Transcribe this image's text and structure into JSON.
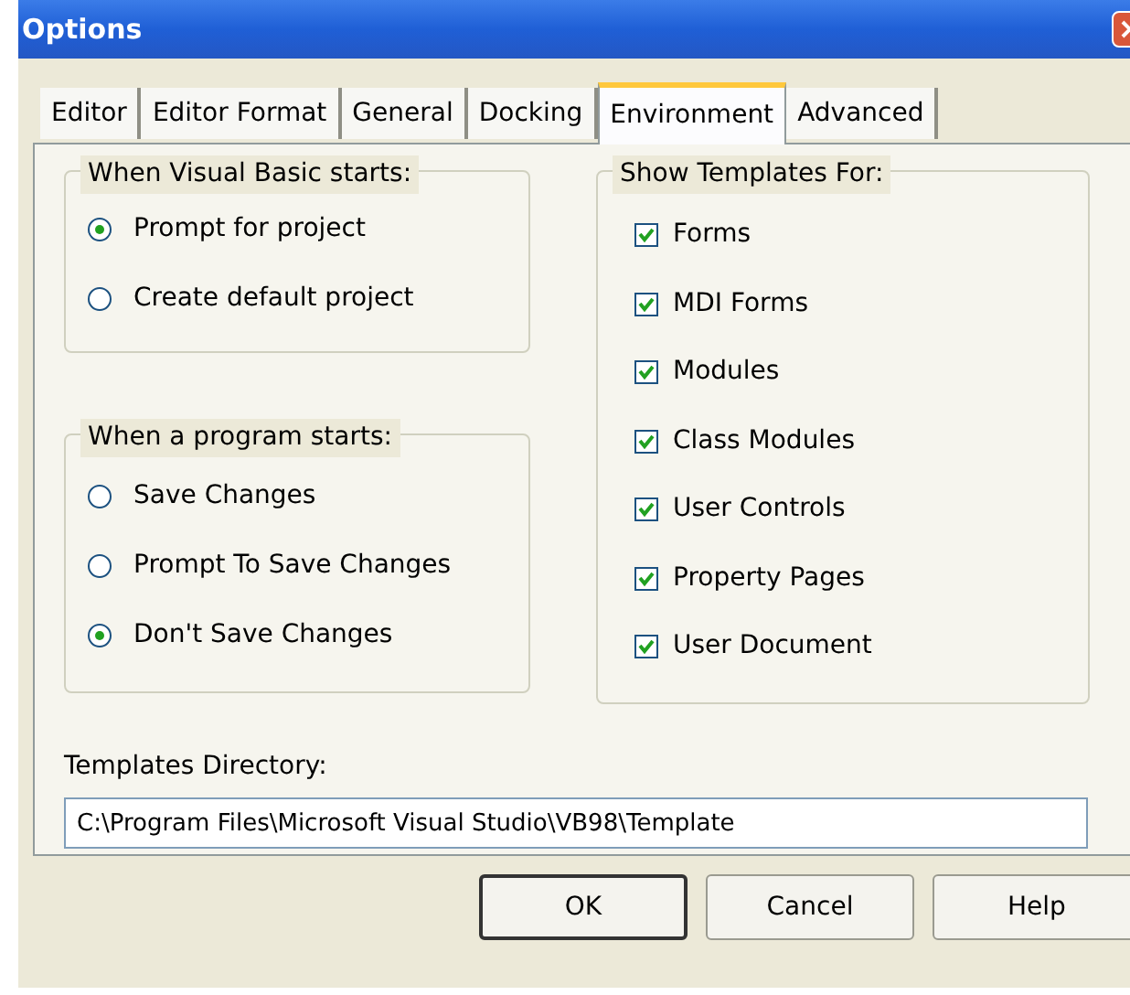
{
  "window": {
    "title": "Options"
  },
  "tabs": [
    {
      "label": "Editor",
      "selected": false
    },
    {
      "label": "Editor Format",
      "selected": false
    },
    {
      "label": "General",
      "selected": false
    },
    {
      "label": "Docking",
      "selected": false
    },
    {
      "label": "Environment",
      "selected": true
    },
    {
      "label": "Advanced",
      "selected": false
    }
  ],
  "vb_starts": {
    "title": "When Visual Basic starts:",
    "options": [
      {
        "label": "Prompt for project",
        "selected": true
      },
      {
        "label": "Create default project",
        "selected": false
      }
    ]
  },
  "program_starts": {
    "title": "When a program starts:",
    "options": [
      {
        "label": "Save Changes",
        "selected": false
      },
      {
        "label": "Prompt To Save Changes",
        "selected": false
      },
      {
        "label": "Don't Save Changes",
        "selected": true
      }
    ]
  },
  "show_templates": {
    "title": "Show Templates For:",
    "items": [
      {
        "label": "Forms",
        "checked": true
      },
      {
        "label": "MDI Forms",
        "checked": true
      },
      {
        "label": "Modules",
        "checked": true
      },
      {
        "label": "Class Modules",
        "checked": true
      },
      {
        "label": "User Controls",
        "checked": true
      },
      {
        "label": "Property Pages",
        "checked": true
      },
      {
        "label": "User Document",
        "checked": true
      }
    ]
  },
  "templates_directory": {
    "label": "Templates Directory:",
    "value": "C:\\Program Files\\Microsoft Visual Studio\\VB98\\Template"
  },
  "buttons": [
    "OK",
    "Cancel",
    "Help"
  ]
}
